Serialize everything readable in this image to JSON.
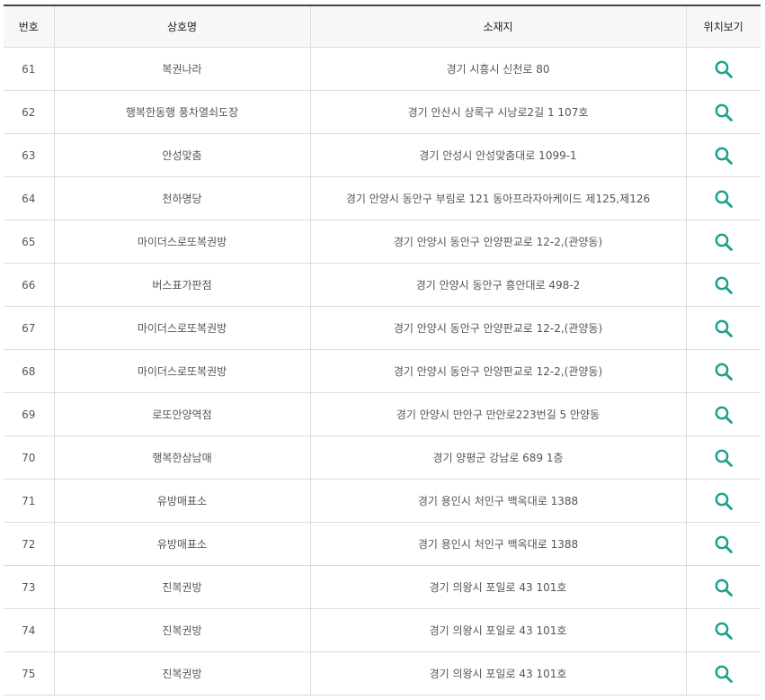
{
  "table": {
    "headers": {
      "number": "번호",
      "name": "상호명",
      "address": "소재지",
      "location": "위치보기"
    },
    "accent_color": "#1aa08c",
    "location_icon": "search-icon",
    "rows": [
      {
        "number": "61",
        "name": "복권나라",
        "address": "경기 시흥시 신천로 80"
      },
      {
        "number": "62",
        "name": "행복한동행 풍차열쇠도장",
        "address": "경기 안산시 상록구 시낭로2길 1 107호"
      },
      {
        "number": "63",
        "name": "안성맞춤",
        "address": "경기 안성시 안성맞춤대로 1099-1"
      },
      {
        "number": "64",
        "name": "천하명당",
        "address": "경기 안양시 동안구 부림로 121 동아프라자아케이드 제125,제126"
      },
      {
        "number": "65",
        "name": "마이더스로또복권방",
        "address": "경기 안양시 동안구 안양판교로 12-2,(관양동)"
      },
      {
        "number": "66",
        "name": "버스표가판점",
        "address": "경기 안양시 동안구 흥안대로 498-2"
      },
      {
        "number": "67",
        "name": "마이더스로또복권방",
        "address": "경기 안양시 동안구 안양판교로 12-2,(관양동)"
      },
      {
        "number": "68",
        "name": "마이더스로또복권방",
        "address": "경기 안양시 동안구 안양판교로 12-2,(관양동)"
      },
      {
        "number": "69",
        "name": "로또안양역점",
        "address": "경기 안양시 만안구 만안로223번길 5 안양동"
      },
      {
        "number": "70",
        "name": "행복한삼남매",
        "address": "경기 양평군 강남로 689 1층"
      },
      {
        "number": "71",
        "name": "유방매표소",
        "address": "경기 용인시 처인구 백옥대로 1388"
      },
      {
        "number": "72",
        "name": "유방매표소",
        "address": "경기 용인시 처인구 백옥대로 1388"
      },
      {
        "number": "73",
        "name": "진복권방",
        "address": "경기 의왕시 포일로 43 101호"
      },
      {
        "number": "74",
        "name": "진복권방",
        "address": "경기 의왕시 포일로 43 101호"
      },
      {
        "number": "75",
        "name": "진복권방",
        "address": "경기 의왕시 포일로 43 101호"
      }
    ]
  }
}
